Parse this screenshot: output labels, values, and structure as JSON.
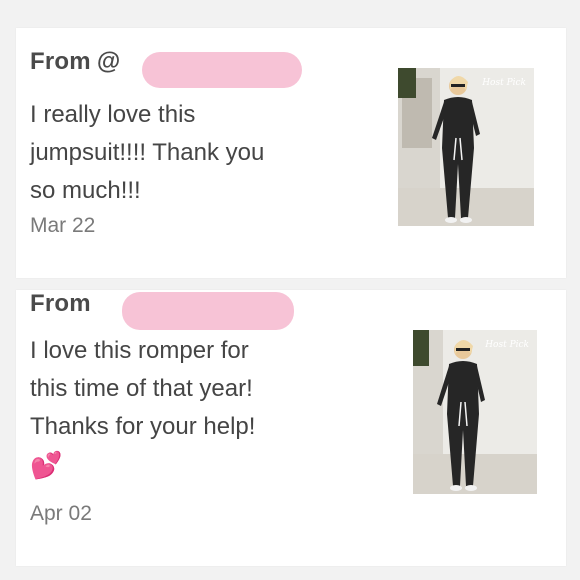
{
  "messages": [
    {
      "from_label": "From",
      "at_sign": "@",
      "text": "I really love this\njumpsuit!!!! Thank you\nso much!!!",
      "date": "Mar 22",
      "watermark": "Host Pick"
    },
    {
      "from_label": "From",
      "text": "I love this romper for\nthis time of that year!\nThanks for your help!",
      "emoji": "💕",
      "date": "Apr 02",
      "watermark": "Host Pick"
    }
  ]
}
